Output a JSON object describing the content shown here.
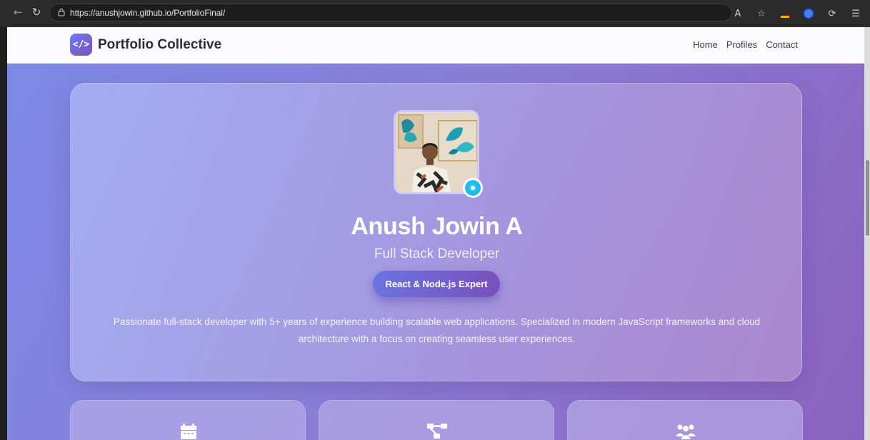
{
  "browser": {
    "url": "https://anushjowin.github.io/PortfolioFinal/",
    "icons": [
      "back-icon",
      "refresh-icon",
      "lock-icon",
      "read-aloud-icon",
      "favorite-star-icon",
      "extension-icon",
      "copilot-icon"
    ]
  },
  "site": {
    "logo_glyph": "</>",
    "brand": "Portfolio Collective",
    "nav": [
      "Home",
      "Profiles",
      "Contact"
    ]
  },
  "hero": {
    "name": "Anush Jowin A",
    "title": "Full Stack Developer",
    "badge": "React & Node.js Expert",
    "bio": "Passionate full-stack developer with 5+ years of experience building scalable web applications. Specialized in modern JavaScript frameworks and cloud architecture with a focus on creating seamless user experiences."
  },
  "feature_cards": [
    {
      "icon": "calendar-icon"
    },
    {
      "icon": "project-diagram-icon"
    },
    {
      "icon": "users-icon"
    }
  ],
  "colors": {
    "gradient_start": "#7b8ae6",
    "gradient_end": "#8b62bf",
    "status_online": "#22b8ee"
  }
}
